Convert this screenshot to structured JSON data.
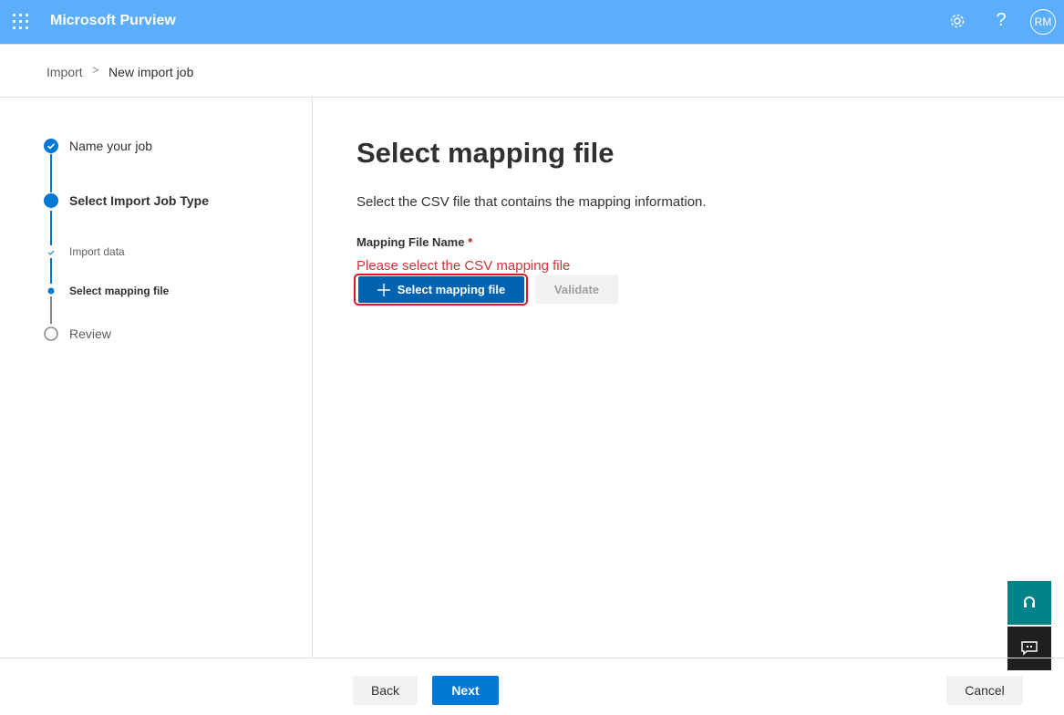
{
  "header": {
    "app_title": "Microsoft Purview",
    "icons": [
      "app-launcher-icon",
      "gear-icon",
      "help-icon"
    ],
    "help_glyph": "?",
    "avatar_initials": "RM"
  },
  "breadcrumb": {
    "items": [
      "Import",
      "New import job"
    ],
    "separator": ">"
  },
  "steps": [
    {
      "label": "Name your job",
      "state": "completed"
    },
    {
      "label": "Select Import Job Type",
      "state": "current"
    },
    {
      "label": "Import data",
      "state": "sub-completed"
    },
    {
      "label": "Select mapping file",
      "state": "sub-current"
    },
    {
      "label": "Review",
      "state": "pending"
    }
  ],
  "main": {
    "title": "Select mapping file",
    "description": "Select the CSV file that contains the mapping information.",
    "field_label": "Mapping File Name",
    "required_marker": "*",
    "error_text": "Please select the CSV mapping file",
    "select_button": "Select mapping file",
    "validate_button": "Validate"
  },
  "footer": {
    "back": "Back",
    "next": "Next",
    "cancel": "Cancel"
  },
  "colors": {
    "header_bg": "#5caefb",
    "accent": "#0078d4",
    "error": "#d13438",
    "highlight": "#e81123",
    "support_fab": "#038387",
    "feedback_fab": "#201f1e"
  }
}
